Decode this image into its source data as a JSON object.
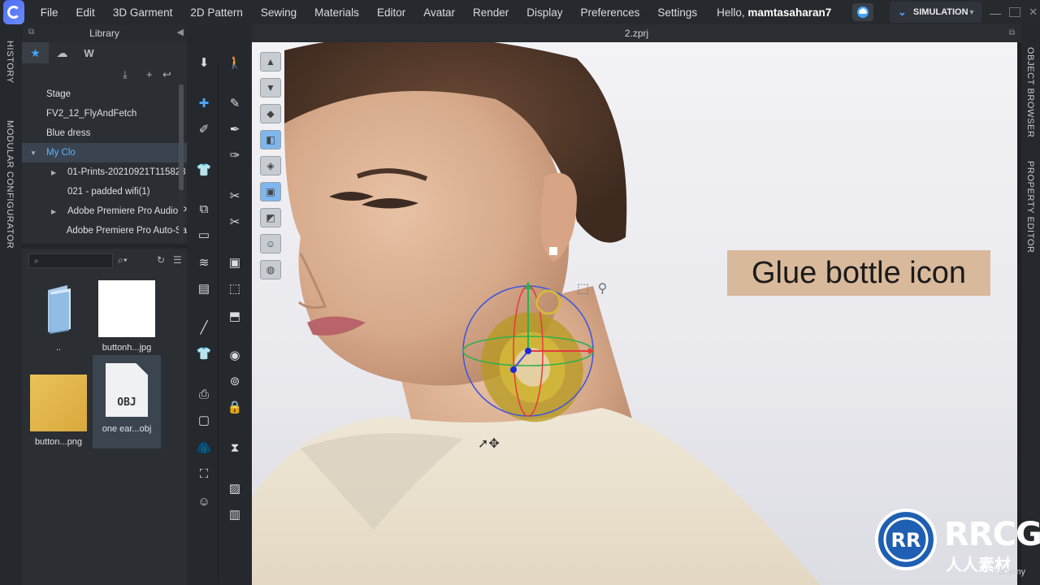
{
  "menubar": {
    "items": [
      "File",
      "Edit",
      "3D Garment",
      "2D Pattern",
      "Sewing",
      "Materials",
      "Editor",
      "Avatar",
      "Render",
      "Display",
      "Preferences",
      "Settings"
    ],
    "hello_prefix": "Hello,",
    "username": "mamtasaharan7",
    "mode_label": "SIMULATION"
  },
  "side_tabs": {
    "left": [
      "HISTORY",
      "MODULAR CONFIGURATOR"
    ],
    "right": [
      "OBJECT BROWSER",
      "PROPERTY EDITOR"
    ]
  },
  "library": {
    "title": "Library",
    "tree": [
      {
        "label": "Stage",
        "indent": 0,
        "arrow": "",
        "selected": false
      },
      {
        "label": "FV2_12_FlyAndFetch",
        "indent": 0,
        "arrow": "",
        "selected": false
      },
      {
        "label": "Blue dress",
        "indent": 0,
        "arrow": "",
        "selected": false
      },
      {
        "label": "My Clo",
        "indent": 0,
        "arrow": "▼",
        "selected": true
      },
      {
        "label": "01-Prints-20210921T115828",
        "indent": 1,
        "arrow": "▶",
        "selected": false
      },
      {
        "label": "021 - padded  wifi(1)",
        "indent": 1,
        "arrow": "",
        "selected": false
      },
      {
        "label": "Adobe Premiere Pro Audio P",
        "indent": 1,
        "arrow": "▶",
        "selected": false
      },
      {
        "label": "Adobe Premiere Pro Auto-Sa",
        "indent": 1,
        "arrow": "",
        "selected": false
      }
    ],
    "search_placeholder": "",
    "files": [
      {
        "caption": "..",
        "kind": "folder"
      },
      {
        "caption": "buttonh...jpg",
        "kind": "white"
      },
      {
        "caption": "button...png",
        "kind": "yellow"
      },
      {
        "caption": "one ear...obj",
        "kind": "obj",
        "badge": "OBJ"
      }
    ]
  },
  "viewport": {
    "file_title": "2.zprj",
    "annotation": "Glue bottle icon"
  },
  "watermark": {
    "brand": "RRCG",
    "sub": "人人素材",
    "credit": "ûdemy"
  },
  "colors": {
    "accent": "#3fa3ff",
    "annotation_bg": "#d9b99b",
    "selected_text": "#5fb0ff"
  }
}
